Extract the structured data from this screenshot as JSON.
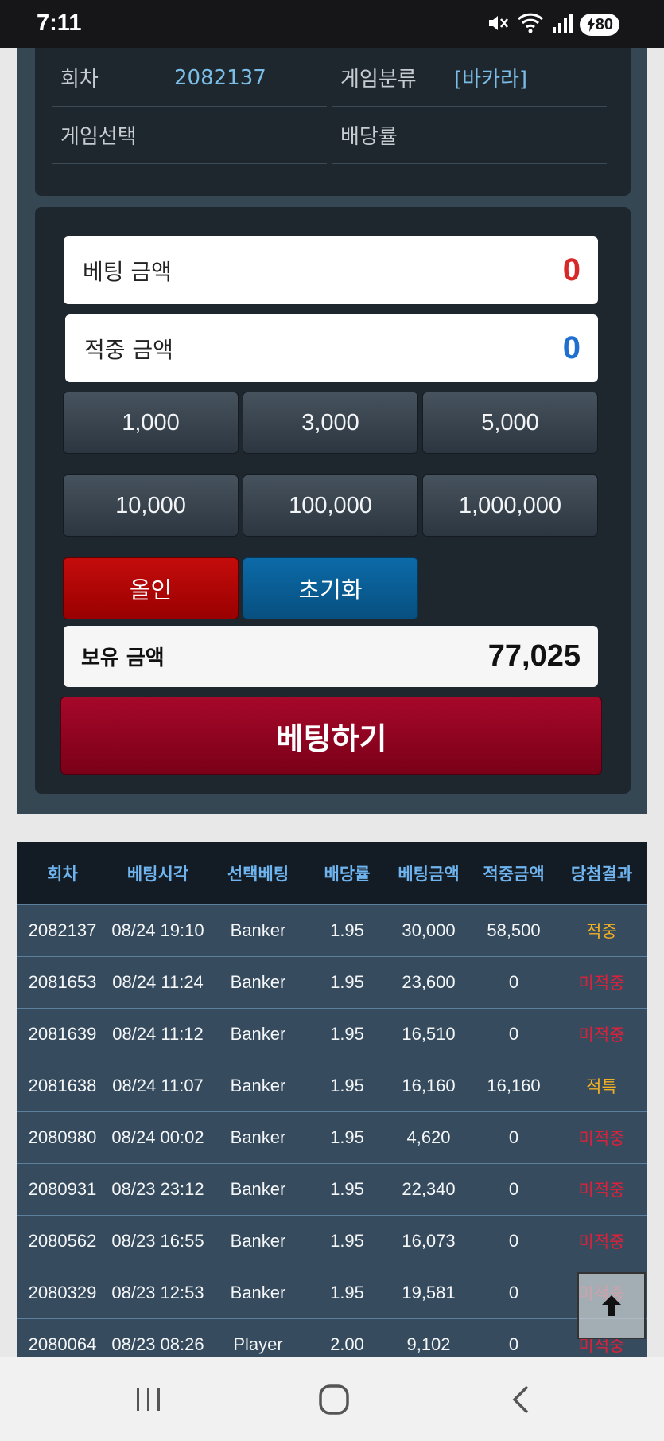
{
  "status_bar": {
    "time": "7:11",
    "battery": "80",
    "icons": [
      "mute-icon",
      "wifi-icon",
      "signal-icon",
      "battery-icon"
    ]
  },
  "game_info": {
    "round_label": "회차",
    "round_value": "2082137",
    "category_label": "게임분류",
    "category_value": "[바카라]",
    "selection_label": "게임선택",
    "selection_value": "",
    "odds_label": "배당률",
    "odds_value": ""
  },
  "betting": {
    "bet_amount_label": "베팅 금액",
    "bet_amount_value": "0",
    "win_amount_label": "적중 금액",
    "win_amount_value": "0",
    "chips": [
      "1,000",
      "3,000",
      "5,000",
      "10,000",
      "100,000",
      "1,000,000"
    ],
    "allin_label": "올인",
    "reset_label": "초기화",
    "holding_label": "보유 금액",
    "holding_value": "77,025",
    "submit_label": "베팅하기"
  },
  "history": {
    "headers": [
      "회차",
      "베팅시각",
      "선택베팅",
      "배당률",
      "베팅금액",
      "적중금액",
      "당첨결과"
    ],
    "rows": [
      [
        "2082137",
        "08/24 19:10",
        "Banker",
        "1.95",
        "30,000",
        "58,500",
        "적중"
      ],
      [
        "2081653",
        "08/24 11:24",
        "Banker",
        "1.95",
        "23,600",
        "0",
        "미적중"
      ],
      [
        "2081639",
        "08/24 11:12",
        "Banker",
        "1.95",
        "16,510",
        "0",
        "미적중"
      ],
      [
        "2081638",
        "08/24 11:07",
        "Banker",
        "1.95",
        "16,160",
        "16,160",
        "적특"
      ],
      [
        "2080980",
        "08/24 00:02",
        "Banker",
        "1.95",
        "4,620",
        "0",
        "미적중"
      ],
      [
        "2080931",
        "08/23 23:12",
        "Banker",
        "1.95",
        "22,340",
        "0",
        "미적중"
      ],
      [
        "2080562",
        "08/23 16:55",
        "Banker",
        "1.95",
        "16,073",
        "0",
        "미적중"
      ],
      [
        "2080329",
        "08/23 12:53",
        "Banker",
        "1.95",
        "19,581",
        "0",
        "미적중"
      ],
      [
        "2080064",
        "08/23 08:26",
        "Player",
        "2.00",
        "9,102",
        "0",
        "미적중"
      ]
    ]
  },
  "colors": {
    "bet_amount": "#d7282a",
    "win_amount": "#1f6fd0",
    "result_win": "#f0b024",
    "result_lose": "#e0203a"
  }
}
